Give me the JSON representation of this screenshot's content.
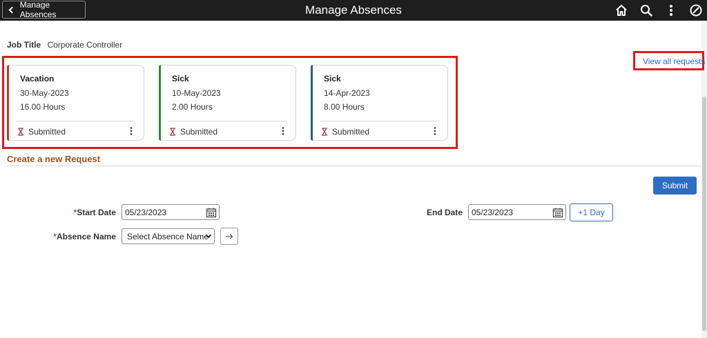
{
  "header": {
    "back_label": "Manage Absences",
    "title": "Manage Absences",
    "icons": [
      "home-icon",
      "search-icon",
      "more-vertical-icon",
      "navbar-icon"
    ]
  },
  "job": {
    "label": "Job Title",
    "value": "Corporate Controller"
  },
  "requests": {
    "view_all_label": "View all requests",
    "cards": [
      {
        "type": "Vacation",
        "date": "30-May-2023",
        "hours": "16.00 Hours",
        "status": "Submitted",
        "stripe_color": "#c0392b"
      },
      {
        "type": "Sick",
        "date": "10-May-2023",
        "hours": "2.00 Hours",
        "status": "Submitted",
        "stripe_color": "#2e8b3a"
      },
      {
        "type": "Sick",
        "date": "14-Apr-2023",
        "hours": "8.00 Hours",
        "status": "Submitted",
        "stripe_color": "#2a5d7c"
      }
    ]
  },
  "form": {
    "section_title": "Create a new Request",
    "submit_label": "Submit",
    "start_date_label": "Start Date",
    "start_date_value": "05/23/2023",
    "end_date_label": "End Date",
    "end_date_value": "05/23/2023",
    "plus_day_label": "+1 Day",
    "absence_name_label": "Absence Name",
    "absence_name_value": "Select Absence Name",
    "required_marker": "*"
  },
  "colors": {
    "accent": "#2f6dc2",
    "section_heading": "#a0521a",
    "highlight": "#e01919",
    "topbar": "#1e1e1e"
  }
}
